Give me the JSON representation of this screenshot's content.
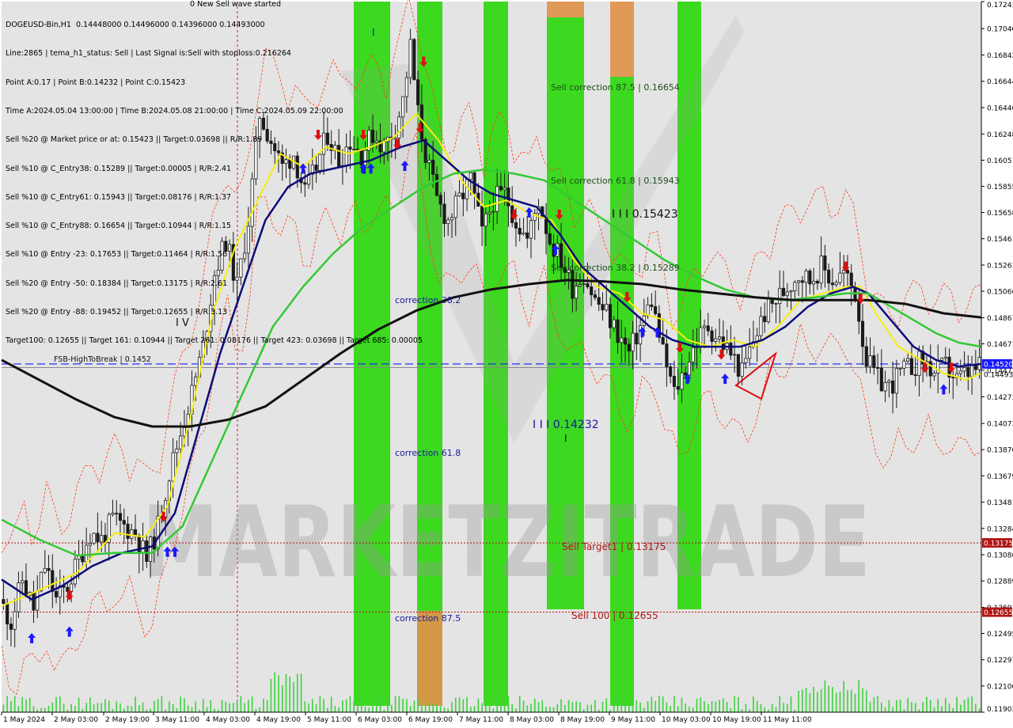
{
  "colors": {
    "background": "#ffffff",
    "plot_bg": "#e4e4e4",
    "green_band": "#2ed80f",
    "orange_band": "#e0924a",
    "candle": "#1a1a1a",
    "ma_yellow": "#f5ee0c",
    "ma_navy": "#0c0c7a",
    "ma_green": "#33c933",
    "ma_black": "#111111",
    "envelope": "#ff3b16",
    "dash_blue": "#1a1aff",
    "target_red": "#b01515",
    "watermark": "#9a9a9a"
  },
  "info_lines": [
    "DOGEUSD-Bin,H1  0.14448000 0.14496000 0.14396000 0.14493000",
    "Line:2865 | tema_h1_status: Sell | Last Signal is:Sell with stoploss:0.216264",
    "Point A:0.17 | Point B:0.14232 | Point C:0.15423",
    "Time A:2024.05.04 13:00:00 | Time B:2024.05.08 21:00:00 | Time C:2024.05.09 22:00:00",
    "Sell %20 @ Market price or at: 0.15423 || Target:0.03698 || R/R:1.89",
    "Sell %10 @ C_Entry38: 0.15289 || Target:0.00005 | R/R:2.41",
    "Sell %10 @ C_Entry61: 0.15943 || Target:0.08176 | R/R:1.37",
    "Sell %10 @ C_Entry88: 0.16654 || Target:0.10944 | R/R:1.15",
    "Sell %10 @ Entry -23: 0.17653 || Target:0.11464 | R/R:1.56",
    "Sell %20 @ Entry -50: 0.18384 || Target:0.13175 | R/R:2.61",
    "Sell %20 @ Entry -88: 0.19452 || Target:0.12655 | R/R:3.13",
    "Target100: 0.12655 || Target 161: 0.10944 || Target 261: 0.08176 || Target 423: 0.03698 || Target 685: 0.00005"
  ],
  "top_text": "0 New Sell wave started",
  "watermark": "MARKETZITRADE",
  "annotations": {
    "sell_corr_875": "Sell correction 87.5 | 0.16654",
    "sell_corr_618": "Sell correction 61.8 | 0.15943",
    "sell_corr_382": "Sell correction 38.2 | 0.15289",
    "wave_c": "I I I  0.15423",
    "wave_b": "I I I  0.14232",
    "wave_b_mark": "I",
    "wave_a_mark": "I",
    "wave_iv": "I V",
    "corr_382": "correction 38.2",
    "corr_618": "correction 61.8",
    "corr_875": "correction 87.5",
    "sell_target1": "Sell Target1 | 0.13175",
    "sell_100": "Sell 100 | 0.12655",
    "fsb_label": "FSB-HighToBreak | 0.1452"
  },
  "chart_data": {
    "type": "candlestick",
    "symbol": "DOGEUSD-Bin",
    "timeframe": "H1",
    "ylim": [
      0.11903,
      0.17243
    ],
    "y_ticks": [
      0.17243,
      0.1704,
      0.16842,
      0.16644,
      0.16446,
      0.16248,
      0.16051,
      0.15855,
      0.15658,
      0.15461,
      0.15263,
      0.15066,
      0.14867,
      0.14671,
      0.14473,
      0.14273,
      0.14073,
      0.13876,
      0.13679,
      0.13481,
      0.13284,
      0.13086,
      0.12889,
      0.12691,
      0.12495,
      0.12297,
      0.121,
      0.11903
    ],
    "y_tick_labels": [
      "0.17243",
      "0.17040",
      "0.16842",
      "0.16644",
      "0.16446",
      "0.16248",
      "0.16051",
      "0.15855",
      "0.15658",
      "0.15461",
      "0.15263",
      "0.15066",
      "0.14867",
      "0.14671",
      "0.14473",
      "0.14273",
      "0.14073",
      "0.13876",
      "0.13679",
      "0.13481",
      "0.13284",
      "0.13086",
      "0.12889",
      "0.12691",
      "0.12495",
      "0.12297",
      "0.12100",
      "0.11903"
    ],
    "x_tick_labels": [
      "1 May 2024",
      "2 May 03:00",
      "2 May 19:00",
      "3 May 11:00",
      "4 May 03:00",
      "4 May 19:00",
      "5 May 11:00",
      "6 May 03:00",
      "6 May 19:00",
      "7 May 11:00",
      "8 May 03:00",
      "8 May 19:00",
      "9 May 11:00",
      "10 May 03:00",
      "10 May 19:00",
      "11 May 11:00"
    ],
    "current_price": 0.1452,
    "current_price_label": "0.14520",
    "current_price_label2": "0.14493",
    "levels": [
      {
        "name": "FSB-HighToBreak",
        "value": 0.1452,
        "style": "dashed-blue"
      },
      {
        "name": "Sell Target1",
        "value": 0.13175,
        "label": "0.13175",
        "style": "dotted-red"
      },
      {
        "name": "Sell 100",
        "value": 0.12655,
        "label": "0.12655",
        "style": "dotted-red"
      }
    ],
    "price_path": [
      [
        0,
        0.1275
      ],
      [
        3,
        0.1258
      ],
      [
        6,
        0.129
      ],
      [
        9,
        0.1268
      ],
      [
        12,
        0.13
      ],
      [
        15,
        0.1275
      ],
      [
        18,
        0.1285
      ],
      [
        21,
        0.1305
      ],
      [
        24,
        0.1325
      ],
      [
        27,
        0.132
      ],
      [
        30,
        0.1335
      ],
      [
        33,
        0.133
      ],
      [
        36,
        0.1325
      ],
      [
        39,
        0.1305
      ],
      [
        42,
        0.133
      ],
      [
        45,
        0.137
      ],
      [
        48,
        0.14
      ],
      [
        51,
        0.143
      ],
      [
        54,
        0.1465
      ],
      [
        57,
        0.152
      ],
      [
        60,
        0.1545
      ],
      [
        63,
        0.151
      ],
      [
        66,
        0.156
      ],
      [
        69,
        0.164
      ],
      [
        72,
        0.162
      ],
      [
        75,
        0.16
      ],
      [
        78,
        0.161
      ],
      [
        81,
        0.158
      ],
      [
        84,
        0.16
      ],
      [
        87,
        0.1625
      ],
      [
        90,
        0.1605
      ],
      [
        93,
        0.162
      ],
      [
        96,
        0.161
      ],
      [
        99,
        0.1625
      ],
      [
        102,
        0.1615
      ],
      [
        105,
        0.163
      ],
      [
        107,
        0.165
      ],
      [
        109,
        0.169
      ],
      [
        111,
        0.164
      ],
      [
        113,
        0.161
      ],
      [
        116,
        0.1575
      ],
      [
        119,
        0.156
      ],
      [
        122,
        0.1575
      ],
      [
        125,
        0.159
      ],
      [
        128,
        0.155
      ],
      [
        131,
        0.1575
      ],
      [
        134,
        0.158
      ],
      [
        137,
        0.156
      ],
      [
        140,
        0.1545
      ],
      [
        143,
        0.1575
      ],
      [
        146,
        0.1545
      ],
      [
        149,
        0.153
      ],
      [
        152,
        0.151
      ],
      [
        155,
        0.152
      ],
      [
        158,
        0.15
      ],
      [
        161,
        0.149
      ],
      [
        164,
        0.1475
      ],
      [
        167,
        0.146
      ],
      [
        170,
        0.148
      ],
      [
        173,
        0.15
      ],
      [
        176,
        0.146
      ],
      [
        179,
        0.143
      ],
      [
        182,
        0.145
      ],
      [
        185,
        0.147
      ],
      [
        188,
        0.148
      ],
      [
        191,
        0.147
      ],
      [
        194,
        0.146
      ],
      [
        197,
        0.1445
      ],
      [
        200,
        0.147
      ],
      [
        203,
        0.149
      ],
      [
        206,
        0.15
      ],
      [
        209,
        0.151
      ],
      [
        212,
        0.152
      ],
      [
        215,
        0.1515
      ],
      [
        218,
        0.1525
      ],
      [
        221,
        0.1515
      ],
      [
        224,
        0.152
      ],
      [
        227,
        0.1505
      ],
      [
        230,
        0.1455
      ],
      [
        233,
        0.144
      ],
      [
        236,
        0.1435
      ],
      [
        239,
        0.1445
      ],
      [
        242,
        0.145
      ],
      [
        245,
        0.1455
      ],
      [
        248,
        0.1445
      ],
      [
        251,
        0.145
      ],
      [
        254,
        0.144
      ],
      [
        257,
        0.1445
      ],
      [
        260,
        0.1449
      ]
    ],
    "series": [
      {
        "role": "yellow",
        "points": [
          [
            0,
            0.127
          ],
          [
            10,
            0.1282
          ],
          [
            20,
            0.1295
          ],
          [
            30,
            0.1325
          ],
          [
            38,
            0.1322
          ],
          [
            44,
            0.1345
          ],
          [
            50,
            0.141
          ],
          [
            56,
            0.149
          ],
          [
            62,
            0.154
          ],
          [
            68,
            0.1575
          ],
          [
            74,
            0.161
          ],
          [
            80,
            0.16
          ],
          [
            86,
            0.1615
          ],
          [
            92,
            0.161
          ],
          [
            98,
            0.1615
          ],
          [
            104,
            0.1622
          ],
          [
            110,
            0.164
          ],
          [
            116,
            0.162
          ],
          [
            122,
            0.159
          ],
          [
            128,
            0.157
          ],
          [
            134,
            0.1575
          ],
          [
            140,
            0.1565
          ],
          [
            146,
            0.156
          ],
          [
            152,
            0.153
          ],
          [
            158,
            0.151
          ],
          [
            164,
            0.1505
          ],
          [
            170,
            0.149
          ],
          [
            176,
            0.1485
          ],
          [
            182,
            0.147
          ],
          [
            188,
            0.1465
          ],
          [
            194,
            0.147
          ],
          [
            200,
            0.1465
          ],
          [
            206,
            0.148
          ],
          [
            212,
            0.15
          ],
          [
            218,
            0.1505
          ],
          [
            224,
            0.151
          ],
          [
            228,
            0.151
          ],
          [
            232,
            0.149
          ],
          [
            238,
            0.1465
          ],
          [
            244,
            0.1455
          ],
          [
            250,
            0.1445
          ],
          [
            256,
            0.144
          ],
          [
            260,
            0.1445
          ]
        ]
      },
      {
        "role": "navy",
        "points": [
          [
            0,
            0.129
          ],
          [
            8,
            0.1275
          ],
          [
            16,
            0.1285
          ],
          [
            24,
            0.13
          ],
          [
            32,
            0.131
          ],
          [
            40,
            0.1315
          ],
          [
            46,
            0.134
          ],
          [
            52,
            0.14
          ],
          [
            58,
            0.146
          ],
          [
            64,
            0.151
          ],
          [
            70,
            0.156
          ],
          [
            76,
            0.1585
          ],
          [
            82,
            0.1595
          ],
          [
            90,
            0.16
          ],
          [
            98,
            0.1605
          ],
          [
            106,
            0.1615
          ],
          [
            112,
            0.162
          ],
          [
            118,
            0.1605
          ],
          [
            124,
            0.159
          ],
          [
            130,
            0.158
          ],
          [
            136,
            0.1575
          ],
          [
            142,
            0.157
          ],
          [
            148,
            0.155
          ],
          [
            154,
            0.1525
          ],
          [
            160,
            0.151
          ],
          [
            166,
            0.1495
          ],
          [
            172,
            0.148
          ],
          [
            178,
            0.147
          ],
          [
            184,
            0.1465
          ],
          [
            190,
            0.1465
          ],
          [
            196,
            0.1465
          ],
          [
            202,
            0.147
          ],
          [
            208,
            0.148
          ],
          [
            214,
            0.1495
          ],
          [
            220,
            0.1505
          ],
          [
            226,
            0.151
          ],
          [
            230,
            0.1505
          ],
          [
            236,
            0.1485
          ],
          [
            242,
            0.1465
          ],
          [
            248,
            0.1455
          ],
          [
            254,
            0.145
          ],
          [
            260,
            0.1452
          ]
        ]
      },
      {
        "role": "green",
        "points": [
          [
            0,
            0.1335
          ],
          [
            10,
            0.132
          ],
          [
            20,
            0.1308
          ],
          [
            30,
            0.131
          ],
          [
            40,
            0.131
          ],
          [
            48,
            0.133
          ],
          [
            56,
            0.138
          ],
          [
            64,
            0.143
          ],
          [
            72,
            0.148
          ],
          [
            80,
            0.151
          ],
          [
            88,
            0.1535
          ],
          [
            96,
            0.1555
          ],
          [
            104,
            0.157
          ],
          [
            112,
            0.1585
          ],
          [
            120,
            0.1595
          ],
          [
            128,
            0.1598
          ],
          [
            136,
            0.1595
          ],
          [
            144,
            0.159
          ],
          [
            152,
            0.1575
          ],
          [
            160,
            0.156
          ],
          [
            168,
            0.1545
          ],
          [
            176,
            0.153
          ],
          [
            184,
            0.1518
          ],
          [
            192,
            0.1508
          ],
          [
            200,
            0.1502
          ],
          [
            208,
            0.15
          ],
          [
            216,
            0.1502
          ],
          [
            224,
            0.1505
          ],
          [
            230,
            0.1505
          ],
          [
            236,
            0.1495
          ],
          [
            242,
            0.1485
          ],
          [
            248,
            0.1475
          ],
          [
            254,
            0.1468
          ],
          [
            260,
            0.1465
          ]
        ]
      },
      {
        "role": "black",
        "points": [
          [
            0,
            0.1455
          ],
          [
            10,
            0.144
          ],
          [
            20,
            0.1425
          ],
          [
            30,
            0.1412
          ],
          [
            40,
            0.1405
          ],
          [
            50,
            0.1405
          ],
          [
            60,
            0.141
          ],
          [
            70,
            0.142
          ],
          [
            80,
            0.144
          ],
          [
            90,
            0.146
          ],
          [
            100,
            0.1478
          ],
          [
            110,
            0.1492
          ],
          [
            120,
            0.1502
          ],
          [
            130,
            0.1508
          ],
          [
            140,
            0.1512
          ],
          [
            150,
            0.1515
          ],
          [
            160,
            0.1514
          ],
          [
            170,
            0.1512
          ],
          [
            180,
            0.1508
          ],
          [
            190,
            0.1505
          ],
          [
            200,
            0.1502
          ],
          [
            210,
            0.15
          ],
          [
            220,
            0.15
          ],
          [
            230,
            0.15
          ],
          [
            240,
            0.1497
          ],
          [
            250,
            0.149
          ],
          [
            260,
            0.1487
          ]
        ]
      }
    ],
    "buy_arrows": [
      [
        8,
        0.1245
      ],
      [
        18,
        0.125
      ],
      [
        44,
        0.131
      ],
      [
        46,
        0.131
      ],
      [
        80,
        0.1598
      ],
      [
        96,
        0.1598
      ],
      [
        98,
        0.1598
      ],
      [
        107,
        0.16
      ],
      [
        140,
        0.1565
      ],
      [
        147,
        0.1537
      ],
      [
        170,
        0.1475
      ],
      [
        174,
        0.1475
      ],
      [
        182,
        0.144
      ],
      [
        192,
        0.144
      ],
      [
        250,
        0.1432
      ]
    ],
    "sell_arrows": [
      [
        18,
        0.1279
      ],
      [
        43,
        0.1338
      ],
      [
        84,
        0.1625
      ],
      [
        96,
        0.1625
      ],
      [
        105,
        0.1618
      ],
      [
        111,
        0.163
      ],
      [
        112,
        0.168
      ],
      [
        136,
        0.1565
      ],
      [
        148,
        0.1565
      ],
      [
        166,
        0.1503
      ],
      [
        180,
        0.1465
      ],
      [
        191,
        0.146
      ],
      [
        224,
        0.1526
      ],
      [
        228,
        0.1502
      ],
      [
        245,
        0.145
      ],
      [
        252,
        0.145
      ]
    ]
  }
}
